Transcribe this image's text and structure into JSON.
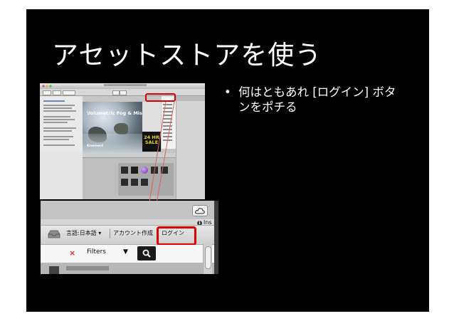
{
  "slide": {
    "title": "アセットストアを使う",
    "bullet_marker": "•",
    "bullet_text": "何はともあれ [ログイン] ボタンをポチる"
  },
  "screenshot_top": {
    "banner_title": "Volumetric Fog & Mist",
    "banner_brand": "Kronnect",
    "sale_text": "24 HR SALE"
  },
  "screenshot_bottom": {
    "language_label": "言語:日本語 ▾",
    "create_account_label": "アカウント作成",
    "login_label": "ログイン",
    "inspector_label": "Ins",
    "inspector_icon_text": "i",
    "filters_label": "Filters",
    "filters_caret": "▼",
    "clear_icon_text": "×"
  },
  "colors": {
    "slide_bg": "#000000",
    "highlight": "#e00000",
    "connector": "#e06060"
  }
}
